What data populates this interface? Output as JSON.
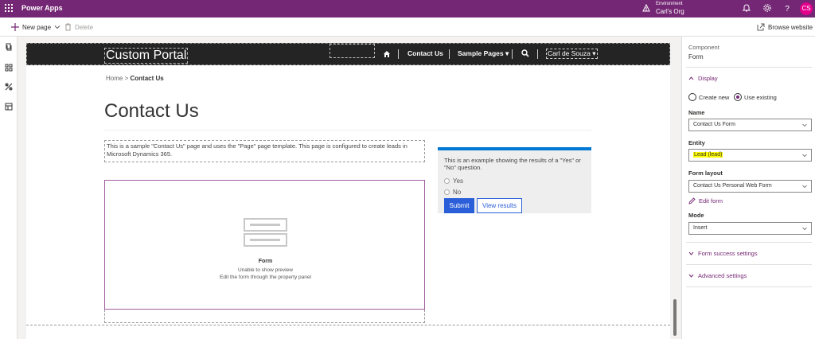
{
  "topbar": {
    "app_name": "Power Apps",
    "environment_label": "Environment",
    "environment_name": "Carl's Org",
    "avatar_initials": "CS"
  },
  "commandbar": {
    "new_page": "New page",
    "delete": "Delete",
    "browse_website": "Browse website"
  },
  "portal": {
    "site_title": "Custom Portal",
    "nav": {
      "contact_us": "Contact Us",
      "sample_pages": "Sample Pages",
      "user_name": "Carl de Souza"
    },
    "breadcrumb": {
      "home": "Home",
      "separator": ">",
      "current": "Contact Us"
    },
    "page_title": "Contact Us",
    "description": "This is a sample \"Contact Us\" page and uses the \"Page\" page template. This page is configured to create leads in Microsoft Dynamics 365.",
    "form_placeholder": {
      "title": "Form",
      "line1": "Unable to show preview",
      "line2": "Edit the form through the property panel"
    },
    "poll": {
      "question": "This is an example showing the results of a \"Yes\" or \"No\" question.",
      "options": [
        "Yes",
        "No"
      ],
      "submit": "Submit",
      "view_results": "View results"
    }
  },
  "panel": {
    "component_label": "Component",
    "component_name": "Form",
    "display_section": "Display",
    "radio_create_new": "Create new",
    "radio_use_existing": "Use existing",
    "name_label": "Name",
    "name_value": "Contact Us Form",
    "entity_label": "Entity",
    "entity_value": "Lead (lead)",
    "form_layout_label": "Form layout",
    "form_layout_value": "Contact Us Personal Web Form",
    "edit_form": "Edit form",
    "mode_label": "Mode",
    "mode_value": "Insert",
    "form_success_settings": "Form success settings",
    "advanced_settings": "Advanced settings"
  },
  "colors": {
    "brand_purple": "#742774",
    "portal_nav": "#242424",
    "submit_blue": "#2b5fd9",
    "poll_accent": "#0078d4",
    "highlight": "#ffff00",
    "avatar": "#e3008c"
  }
}
